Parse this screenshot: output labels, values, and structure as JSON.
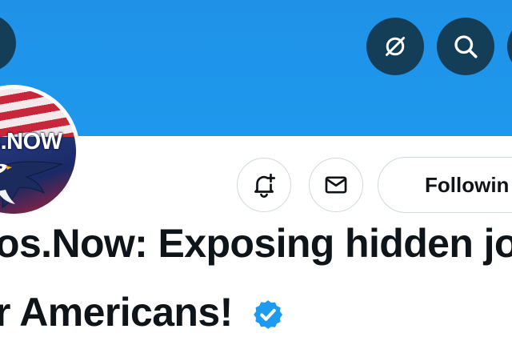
{
  "header": {
    "icons": {
      "back": "arrow-left-icon",
      "mute": "no-signal-icon",
      "search": "search-icon",
      "more": "more-icon"
    }
  },
  "profile": {
    "avatar_text": "s.NOW",
    "name_line1": "os.Now: Exposing hidden jo",
    "name_line2": "r Americans!",
    "verified_icon": "verified-badge-icon"
  },
  "actions": {
    "notify_icon": "bell-plus-icon",
    "message_icon": "envelope-icon",
    "following_label": "Followin"
  },
  "colors": {
    "banner": "#1d96ea",
    "header_button": "#143e58",
    "verified": "#1d9bf0",
    "text": "#0f1419",
    "border": "#cfd9de"
  }
}
